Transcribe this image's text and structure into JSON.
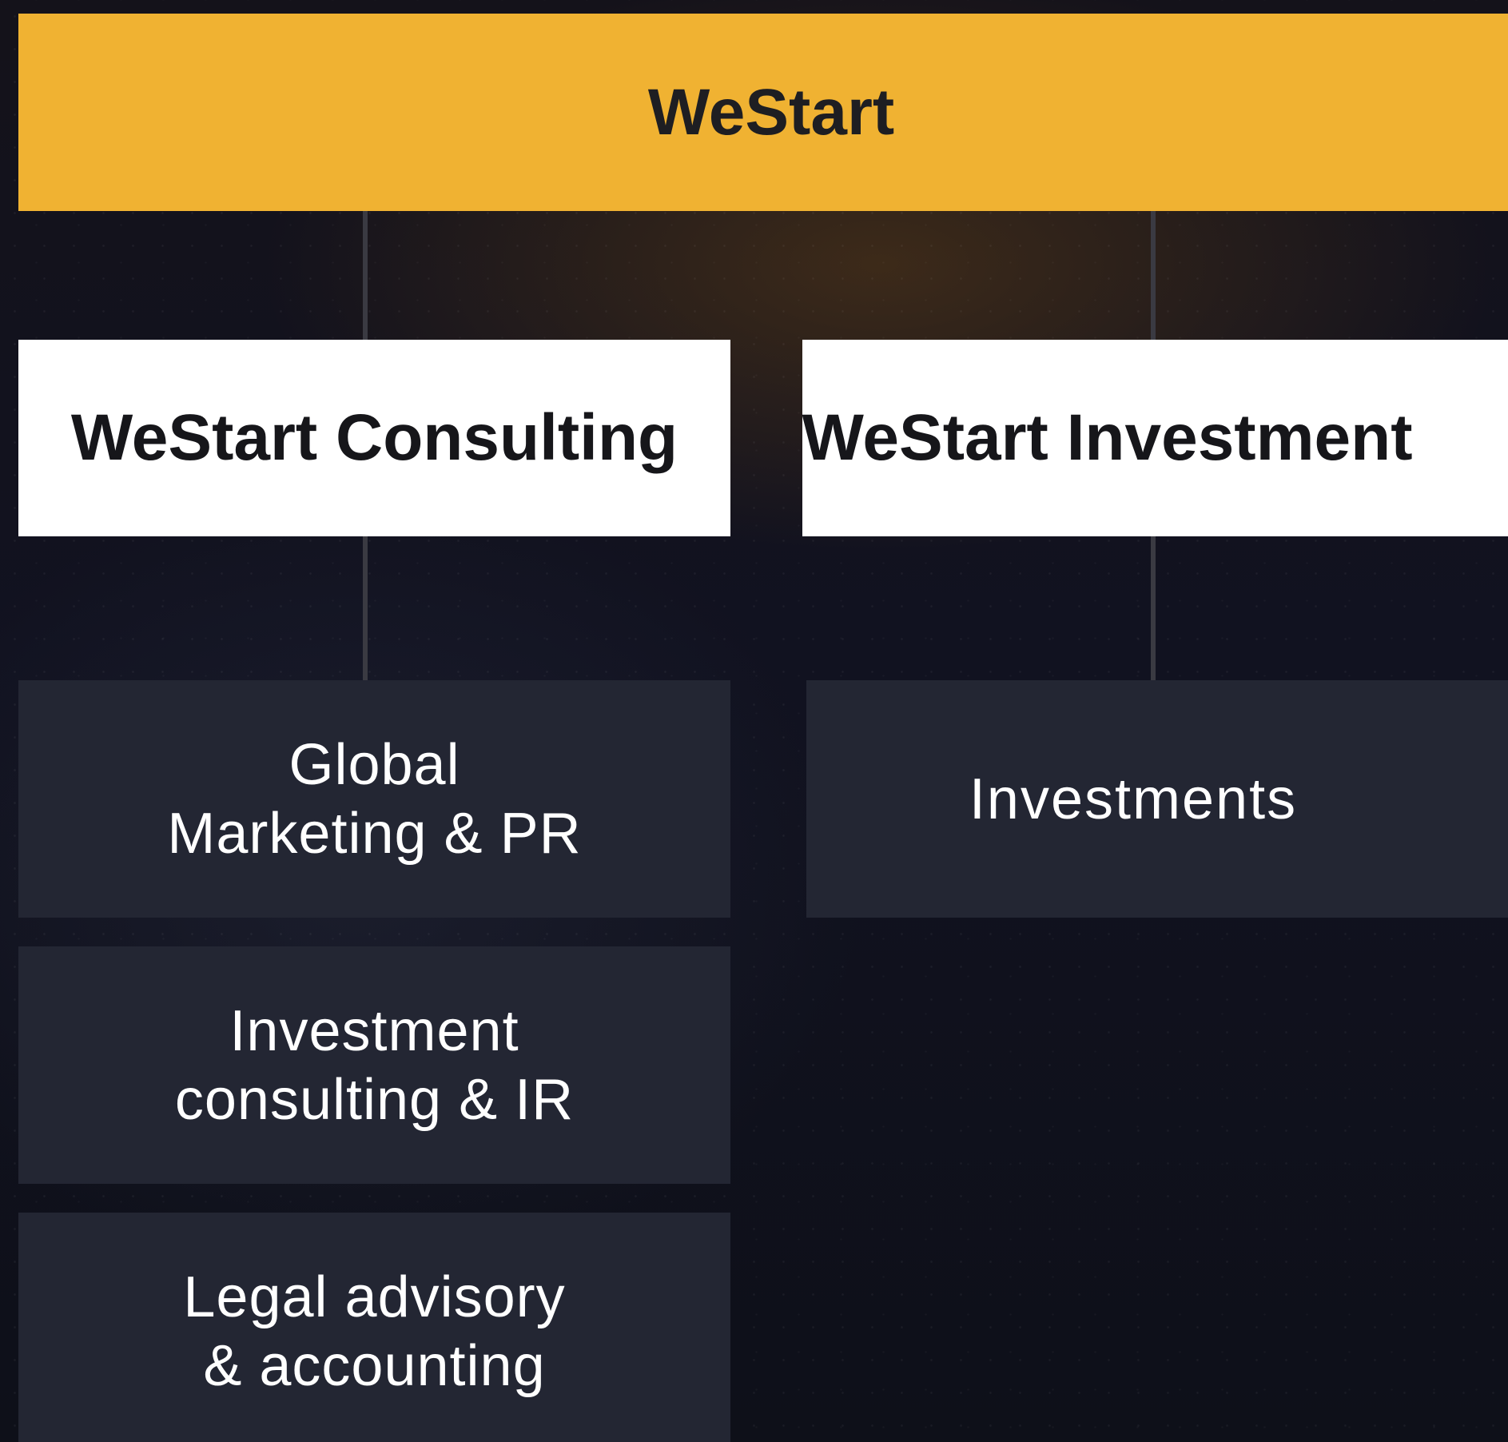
{
  "root": {
    "label": "WeStart"
  },
  "companies": [
    {
      "label": "WeStart Consulting"
    },
    {
      "label": "WeStart Investment"
    }
  ],
  "consulting_services": [
    {
      "label": "Global\nMarketing & PR"
    },
    {
      "label": "Investment\nconsulting & IR"
    },
    {
      "label": "Legal advisory\n& accounting"
    }
  ],
  "investment_services": [
    {
      "label": "Investments"
    }
  ],
  "colors": {
    "root_fill": "#f0b232",
    "company_fill": "#ffffff",
    "service_fill": "#232633",
    "background": "#111220",
    "connector": "#3a3a42"
  }
}
